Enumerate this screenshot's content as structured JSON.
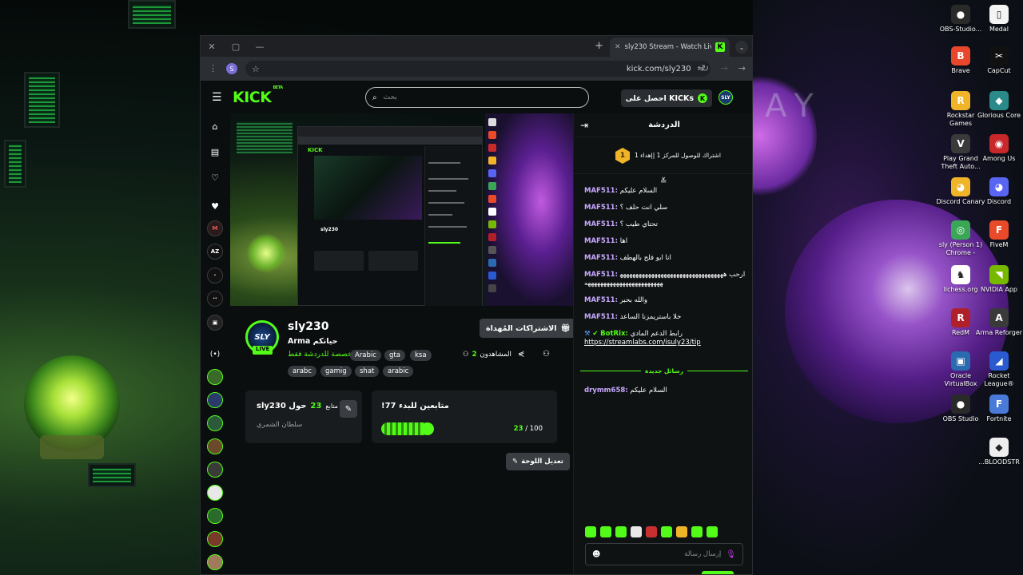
{
  "desktop": {
    "icons": [
      {
        "label": "OBS-Studio...",
        "color": "#2a2a2a",
        "glyph": "●",
        "icon": "obs-icon"
      },
      {
        "label": "Medal",
        "color": "#f4f4f4",
        "glyph": "▯",
        "icon": "medal-app-icon"
      },
      {
        "label": "Brave",
        "color": "#e8472b",
        "glyph": "B",
        "icon": "brave-icon"
      },
      {
        "label": "CapCut",
        "color": "#111111",
        "glyph": "✂",
        "icon": "capcut-icon"
      },
      {
        "label": "Rockstar Games",
        "color": "#f0b429",
        "glyph": "R",
        "icon": "rockstar-icon"
      },
      {
        "label": "Glorious Core",
        "color": "#2a8a8a",
        "glyph": "◆",
        "icon": "glorious-core-icon"
      },
      {
        "label": "Play Grand Theft Auto...",
        "color": "#3a3a3a",
        "glyph": "V",
        "icon": "gta-icon"
      },
      {
        "label": "Among Us",
        "color": "#c8282a",
        "glyph": "◉",
        "icon": "among-us-icon"
      },
      {
        "label": "Discord Canary",
        "color": "#f0b429",
        "glyph": "◕",
        "icon": "discord-canary-icon"
      },
      {
        "label": "Discord",
        "color": "#5865f2",
        "glyph": "◕",
        "icon": "discord-icon"
      },
      {
        "label": "sly (Person 1) Chrome -",
        "color": "#3aa757",
        "glyph": "◎",
        "icon": "chrome-icon"
      },
      {
        "label": "FiveM",
        "color": "#e84a2a",
        "glyph": "F",
        "icon": "fivem-icon"
      },
      {
        "label": "lichess.org",
        "color": "#ffffff",
        "glyph": "♞",
        "icon": "lichess-icon"
      },
      {
        "label": "NVIDIA App",
        "color": "#76b900",
        "glyph": "◥",
        "icon": "nvidia-icon"
      },
      {
        "label": "RedM",
        "color": "#b0202a",
        "glyph": "R",
        "icon": "redm-icon"
      },
      {
        "label": "Arma Reforger",
        "color": "#3a3a3a",
        "glyph": "A",
        "icon": "arma-reforger-icon"
      },
      {
        "label": "Oracle VirtualBox",
        "color": "#2a6ab0",
        "glyph": "▣",
        "icon": "virtualbox-icon"
      },
      {
        "label": "Rocket League®",
        "color": "#2a5ad0",
        "glyph": "◢",
        "icon": "rocket-league-icon"
      },
      {
        "label": "OBS Studio",
        "color": "#2a2a2a",
        "glyph": "●",
        "icon": "obs-studio-icon"
      },
      {
        "label": "Fortnite",
        "color": "#4a7ad8",
        "glyph": "F",
        "icon": "fortnite-icon"
      },
      {
        "label": "...BLOODSTR",
        "color": "#eeeeee",
        "glyph": "◆",
        "icon": "bloodstrike-icon"
      }
    ]
  },
  "browser": {
    "tab_title": "sly230 Stream - Watch Live on K",
    "url": "kick.com/sly230",
    "profile_initial": "S"
  },
  "kick": {
    "logo": "KICK",
    "logo_badge": "BETA",
    "search_placeholder": "بحث",
    "get_kicks": "احصل على KICKs",
    "channel": {
      "avatar_text": "SLY",
      "live": "LIVE",
      "name": "sly230",
      "title": "Arma حياتكم",
      "category": "مخصصة للدردشة فقط",
      "tags_row1": [
        "Arabic",
        "gta",
        "ksa"
      ],
      "tags_row2": [
        "arabc",
        "gamig",
        "shat",
        "arabic"
      ],
      "gift_button": "الاشتراكات المُهداة",
      "viewers_label": "المشاهدون",
      "viewers_count": "2"
    },
    "about": {
      "title": "sly230 حول",
      "followers_count": "23",
      "followers_label": "متابع",
      "subtitle": "سلطان الشمري"
    },
    "goal": {
      "title": "!متابعين للبدء 77",
      "current": "23",
      "total": "/ 100",
      "progress": 0.23
    },
    "edit_panel": "تعديل اللوحة"
  },
  "chat": {
    "header": "الدردشة",
    "pinned_rank": "1",
    "pinned_text": "1 اشتراك للوصول للمركز 1 |إهداء",
    "messages": [
      {
        "user": "MAF511:",
        "text": "السلام عليكم"
      },
      {
        "user": "MAF511:",
        "text": "سلي انت حلف ؟"
      },
      {
        "user": "MAF511:",
        "text": "تحتاي طيب ؟"
      },
      {
        "user": "MAF511:",
        "text": "اها"
      },
      {
        "user": "MAF511:",
        "text": "انا ابو فلح بالهطف"
      },
      {
        "user": "MAF511:",
        "text": "ارحب ههههههههههههههههههههههههههههههههههههههههههههههههههههههههههه"
      },
      {
        "user": "MAF511:",
        "text": "والله بحبر"
      },
      {
        "user": "MAF511:",
        "text": "خلا باستريمزنا الساعد"
      }
    ],
    "bot_user": "BotRix:",
    "bot_text": "رابط الدعم المادي",
    "bot_link": "https://streamlabs.com/isuly23/tip",
    "new_messages": "رسائل جديدة",
    "new_msg": {
      "user": "drymm658:",
      "text": "السلام عليكم"
    },
    "input_placeholder": "إرسال رسالة",
    "emote_colors": [
      "#53fc18",
      "#53fc18",
      "#53fc18",
      "#e8e8e8",
      "#c83030",
      "#53fc18",
      "#f0b429",
      "#53fc18",
      "#53fc18"
    ]
  }
}
